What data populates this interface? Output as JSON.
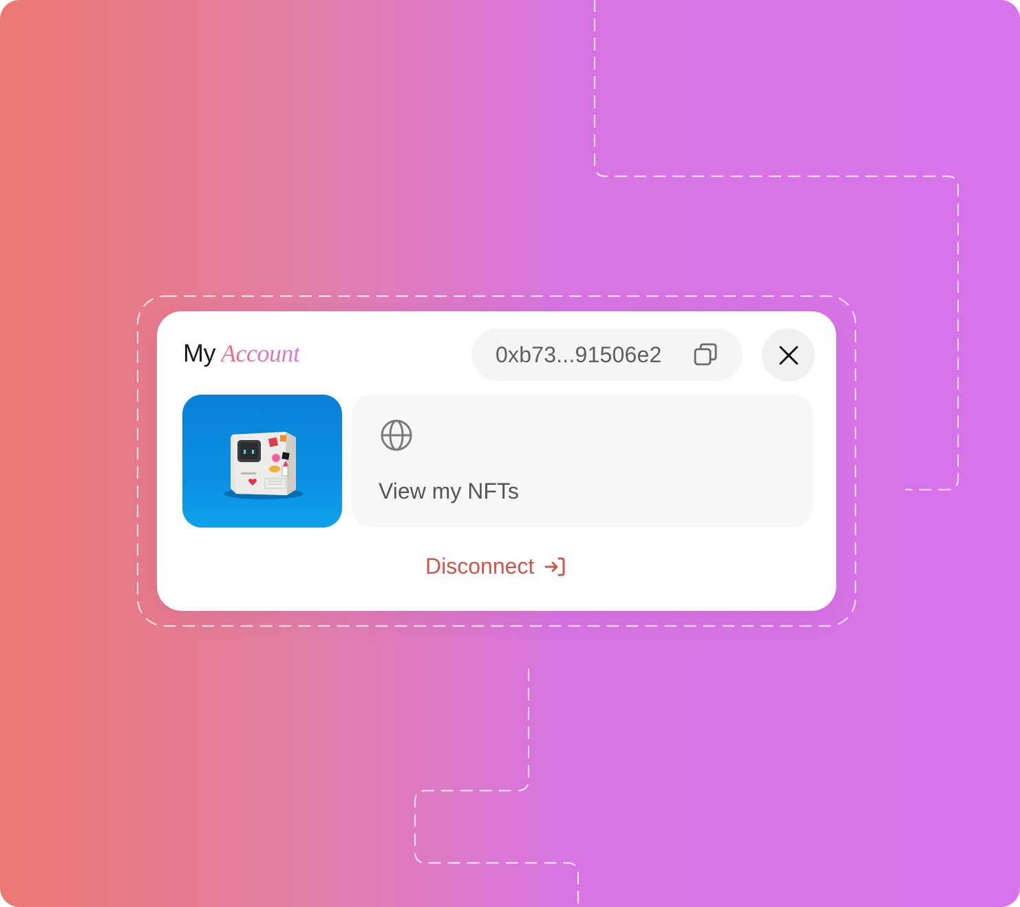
{
  "header": {
    "title_plain": "My",
    "title_accent": "Account"
  },
  "wallet": {
    "address": "0xb73...91506e2",
    "copy_icon": "copy-icon"
  },
  "close": {
    "icon": "close-icon"
  },
  "nft_card": {
    "thumbnail_icon": "retro-computer-nft-image",
    "icon": "globe-icon",
    "label": "View my NFTs"
  },
  "disconnect": {
    "label": "Disconnect",
    "icon": "logout-icon"
  },
  "colors": {
    "gradient_start": "#ec7872",
    "gradient_end": "#d774eb",
    "disconnect": "#c9574c",
    "accent_text": "#e56f84",
    "thumbnail_bg": "#0a8fe0"
  }
}
